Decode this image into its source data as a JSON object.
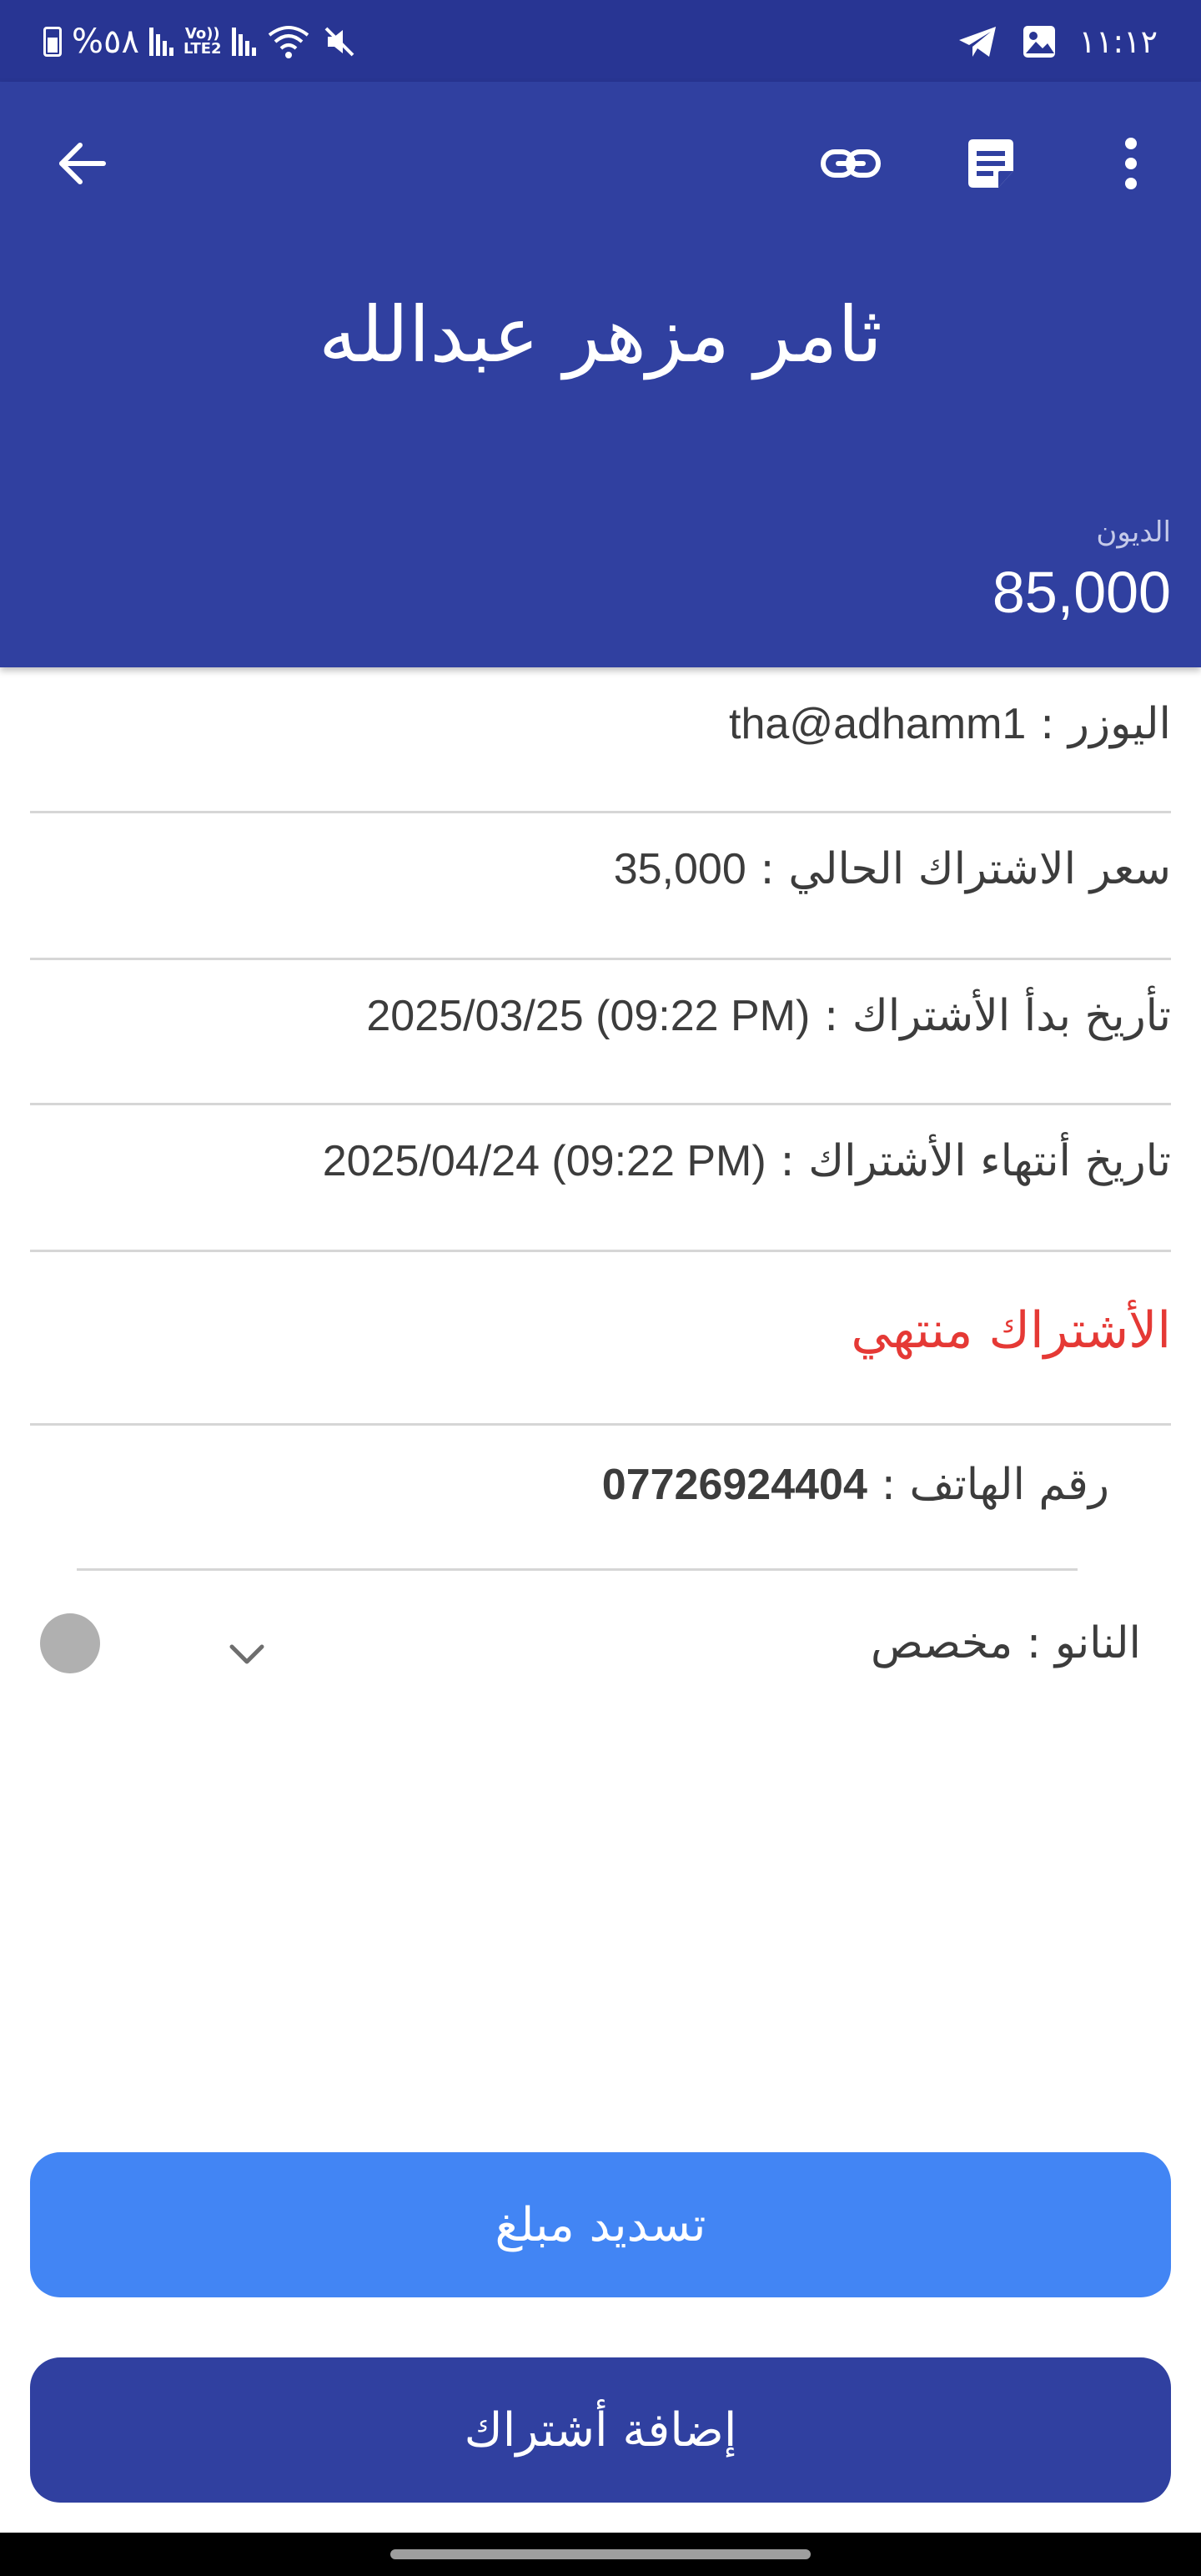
{
  "status_bar": {
    "battery_percent": "%٥٨",
    "network": "LTE2",
    "volte": "Vo))",
    "time": "١١:١٢"
  },
  "header": {
    "customer_name": "ثامر مزهر عبدالله",
    "debt_label": "الديون",
    "debt_value": "85,000",
    "icons": [
      "arrow-back-icon",
      "link-icon",
      "note-icon",
      "more-vert-icon"
    ],
    "background_color": "#3040a0"
  },
  "details": {
    "user_label": "اليوزر :",
    "user_value": "tha@adhamm1",
    "price_label": "سعر الاشتراك الحالي :",
    "price_value": "35,000",
    "start_label": "تأريخ بدأ الأشتراك :",
    "start_value": "2025/03/25 (09:22 PM)",
    "end_label": "تاريخ أنتهاء الأشتراك :",
    "end_value": "2025/04/24 (09:22 PM)",
    "status_text": "الأشتراك منتهي",
    "status_color": "#e53935",
    "phone_label": "رقم الهاتف :",
    "phone_value": "07726924404",
    "nano_label": "النانو :",
    "nano_value": "مخصص"
  },
  "actions": {
    "pay_button": "تسديد مبلغ",
    "add_subscription_button": "إضافة أشتراك",
    "pay_color": "#4285f4",
    "add_color": "#3040a0"
  }
}
